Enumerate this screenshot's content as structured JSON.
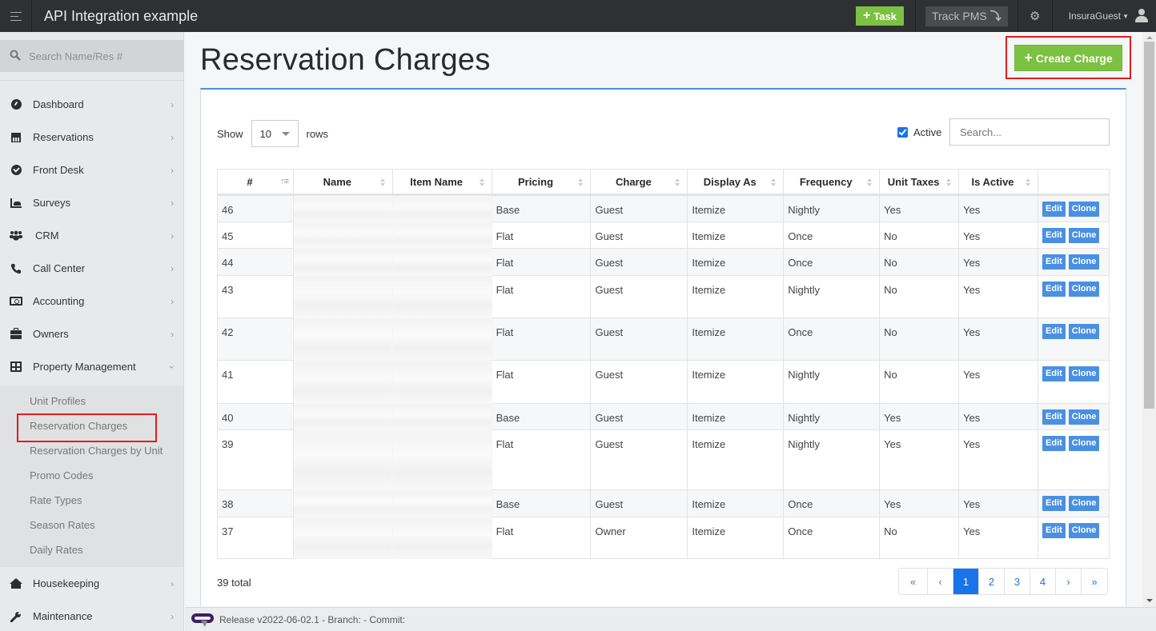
{
  "app": {
    "title": "API Integration example",
    "task_button": "Task",
    "track_button": "Track PMS",
    "track_icon": "arrow-down-turn-icon",
    "settings_icon": "gear-icon",
    "user_name": "InsuraGuest",
    "user_icon": "user-icon"
  },
  "sidebar": {
    "search_placeholder": "Search Name/Res #",
    "items": [
      {
        "label": "Dashboard",
        "icon": "gauge-icon"
      },
      {
        "label": "Reservations",
        "icon": "calendar-icon"
      },
      {
        "label": "Front Desk",
        "icon": "check-circle-icon"
      },
      {
        "label": "Surveys",
        "icon": "area-chart-icon"
      },
      {
        "label": "CRM",
        "icon": "users-icon"
      },
      {
        "label": "Call Center",
        "icon": "phone-icon"
      },
      {
        "label": "Accounting",
        "icon": "money-icon"
      },
      {
        "label": "Owners",
        "icon": "briefcase-icon"
      },
      {
        "label": "Property Management",
        "icon": "grid-icon",
        "expanded": true
      }
    ],
    "sub_items": [
      {
        "label": "Unit Profiles"
      },
      {
        "label": "Reservation Charges",
        "active": true
      },
      {
        "label": "Reservation Charges by Unit"
      },
      {
        "label": "Promo Codes"
      },
      {
        "label": "Rate Types"
      },
      {
        "label": "Season Rates"
      },
      {
        "label": "Daily Rates"
      }
    ],
    "items_after": [
      {
        "label": "Housekeeping",
        "icon": "home-icon"
      },
      {
        "label": "Maintenance",
        "icon": "wrench-icon"
      }
    ]
  },
  "page": {
    "title": "Reservation Charges",
    "create_button": "Create Charge",
    "show_label": "Show",
    "rows_value": "10",
    "rows_label": "rows",
    "active_label": "Active",
    "active_checked": true,
    "search_placeholder": "Search...",
    "total_text": "39 total"
  },
  "table": {
    "columns": [
      "#",
      "Name",
      "Item Name",
      "Pricing",
      "Charge",
      "Display As",
      "Frequency",
      "Unit Taxes",
      "Is Active",
      ""
    ],
    "rows": [
      {
        "id": "46",
        "pricing": "Base",
        "charge": "Guest",
        "display": "Itemize",
        "frequency": "Nightly",
        "unit_taxes": "Yes",
        "is_active": "Yes"
      },
      {
        "id": "45",
        "pricing": "Flat",
        "charge": "Guest",
        "display": "Itemize",
        "frequency": "Once",
        "unit_taxes": "No",
        "is_active": "Yes"
      },
      {
        "id": "44",
        "pricing": "Flat",
        "charge": "Guest",
        "display": "Itemize",
        "frequency": "Once",
        "unit_taxes": "No",
        "is_active": "Yes"
      },
      {
        "id": "43",
        "pricing": "Flat",
        "charge": "Guest",
        "display": "Itemize",
        "frequency": "Nightly",
        "unit_taxes": "No",
        "is_active": "Yes"
      },
      {
        "id": "42",
        "pricing": "Flat",
        "charge": "Guest",
        "display": "Itemize",
        "frequency": "Once",
        "unit_taxes": "No",
        "is_active": "Yes"
      },
      {
        "id": "41",
        "pricing": "Flat",
        "charge": "Guest",
        "display": "Itemize",
        "frequency": "Nightly",
        "unit_taxes": "No",
        "is_active": "Yes"
      },
      {
        "id": "40",
        "pricing": "Base",
        "charge": "Guest",
        "display": "Itemize",
        "frequency": "Nightly",
        "unit_taxes": "Yes",
        "is_active": "Yes"
      },
      {
        "id": "39",
        "pricing": "Flat",
        "charge": "Guest",
        "display": "Itemize",
        "frequency": "Nightly",
        "unit_taxes": "Yes",
        "is_active": "Yes"
      },
      {
        "id": "38",
        "pricing": "Base",
        "charge": "Guest",
        "display": "Itemize",
        "frequency": "Once",
        "unit_taxes": "Yes",
        "is_active": "Yes"
      },
      {
        "id": "37",
        "pricing": "Flat",
        "charge": "Owner",
        "display": "Itemize",
        "frequency": "Once",
        "unit_taxes": "No",
        "is_active": "Yes"
      }
    ],
    "edit_label": "Edit",
    "clone_label": "Clone"
  },
  "pagination": {
    "first": "«",
    "prev": "‹",
    "pages": [
      "1",
      "2",
      "3",
      "4"
    ],
    "current": "1",
    "next": "›",
    "last": "»"
  },
  "footer": {
    "release_text": "Release v2022-06-02.1 - Branch: - Commit:"
  },
  "colors": {
    "accent_green": "#7cc142",
    "accent_blue": "#4a90e2",
    "link_blue": "#1a73e8",
    "highlight_red": "#e11d1d",
    "topbar": "#2f3033"
  }
}
